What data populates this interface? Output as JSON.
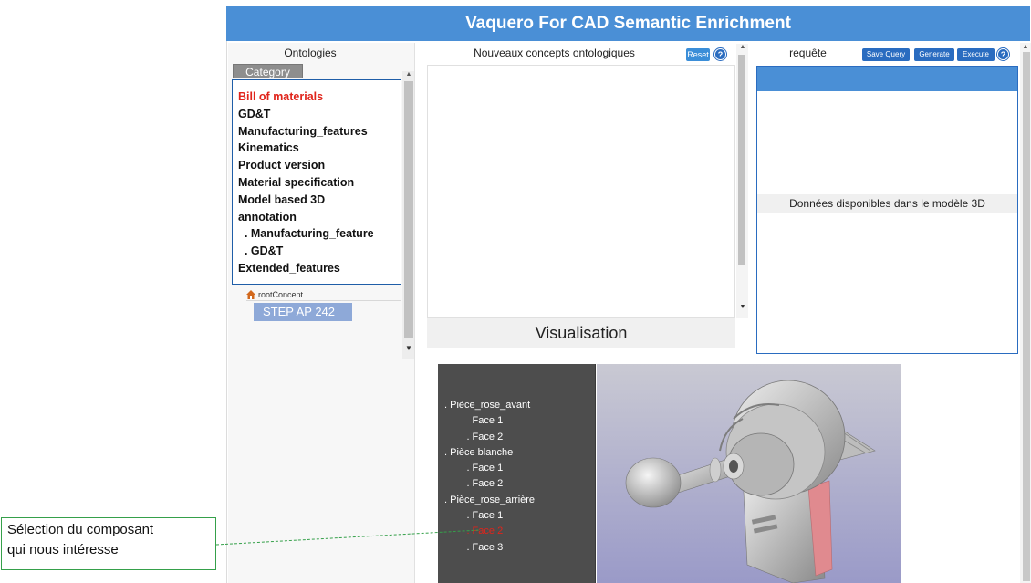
{
  "header": {
    "title": "Vaquero For CAD Semantic Enrichment"
  },
  "left_panel": {
    "title": "Ontologies",
    "category_tab": "Category",
    "categories": [
      {
        "label": "Bill of materials",
        "active": true
      },
      {
        "label": "GD&T",
        "active": false
      },
      {
        "label": "Manufacturing_features",
        "active": false
      },
      {
        "label": "Kinematics",
        "active": false
      },
      {
        "label": "Product version",
        "active": false
      },
      {
        "label": "Material specification",
        "active": false
      },
      {
        "label": "Model based 3D",
        "active": false
      },
      {
        "label": "annotation",
        "active": false
      },
      {
        "label": "  . Manufacturing_feature",
        "active": false
      },
      {
        "label": "  . GD&T",
        "active": false
      },
      {
        "label": "Extended_features",
        "active": false
      }
    ],
    "root_concept": "rootConcept",
    "step_badge": "STEP AP 242"
  },
  "middle_panel": {
    "title": "Nouveaux concepts ontologiques",
    "reset_label": "Reset",
    "help_glyph": "?",
    "visualisation_title": "Visualisation"
  },
  "tree": {
    "items": [
      {
        "label": ". Pièce_rose_avant",
        "selected": false
      },
      {
        "label": "          Face 1",
        "selected": false
      },
      {
        "label": "        . Face 2",
        "selected": false
      },
      {
        "label": ". Pièce blanche",
        "selected": false
      },
      {
        "label": "        . Face 1",
        "selected": false
      },
      {
        "label": "        . Face 2",
        "selected": false
      },
      {
        "label": ". Pièce_rose_arrière",
        "selected": false
      },
      {
        "label": "        . Face 1",
        "selected": false
      },
      {
        "label": "        . Face 2",
        "selected": true
      },
      {
        "label": "        . Face 3",
        "selected": false
      }
    ]
  },
  "right_panel": {
    "title": "requête",
    "save_query_label": "Save Query",
    "generate_label": "Generate",
    "execute_label": "Execute",
    "help_glyph": "?",
    "donnees_label": "Données disponibles dans le modèle 3D"
  },
  "callout": {
    "line1": "Sélection du composant",
    "line2": "qui nous intéresse"
  },
  "colors": {
    "accent": "#4a8fd6",
    "active_category": "#e0241b",
    "callout_border": "#35a04a"
  },
  "icons": [
    "home-icon",
    "help-icon",
    "scroll-arrow-up-icon",
    "scroll-arrow-down-icon"
  ]
}
